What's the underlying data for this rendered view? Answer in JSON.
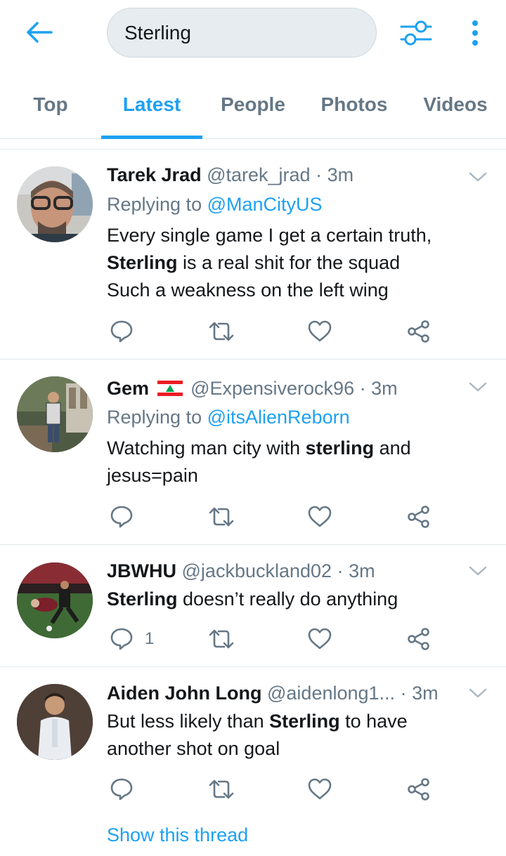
{
  "search": {
    "value": "Sterling"
  },
  "tabs": [
    {
      "label": "Top"
    },
    {
      "label": "Latest"
    },
    {
      "label": "People"
    },
    {
      "label": "Photos"
    },
    {
      "label": "Videos"
    }
  ],
  "active_tab": "Latest",
  "colors": {
    "accent": "#1da1f2",
    "secondary_text": "#657786",
    "primary_text": "#14171a",
    "divider": "#e1e8ed"
  },
  "tweets": [
    {
      "name": "Tarek Jrad",
      "handle": "@tarek_jrad",
      "dot": "·",
      "time": "3m",
      "replying_prefix": "Replying to",
      "replying_to": "@ManCityUS",
      "text_line1": "Every single game I get a certain truth,",
      "text_line2_bold": "Sterling",
      "text_line2_rest": " is a real shit  for the squad",
      "text_line3": "Such a weakness on the left wing"
    },
    {
      "name": "Gem",
      "flag_icon": "lebanon-flag-icon",
      "handle": "@Expensiverock96",
      "dot": "·",
      "time": "3m",
      "replying_prefix": "Replying to",
      "replying_to": "@itsAlienReborn",
      "text_line1_pre": "Watching man city with ",
      "text_line1_bold": "sterling",
      "text_line1_post": " and",
      "text_line2": "jesus=pain"
    },
    {
      "name": "JBWHU",
      "handle": "@jackbuckland02",
      "dot": "·",
      "time": "3m",
      "text_bold": "Sterling",
      "text_rest": " doesn’t really do anything",
      "reply_count": "1"
    },
    {
      "name": "Aiden John Long",
      "handle": "@aidenlong1...",
      "dot": "·",
      "time": "3m",
      "text_line1_pre": "But less likely than ",
      "text_line1_bold": "Sterling",
      "text_line1_post": " to have",
      "text_line2": "another shot on goal",
      "show_thread": "Show this thread"
    }
  ],
  "icons": {
    "back": "arrow-left-icon",
    "filter": "sliders-icon",
    "more": "vertical-dots-icon",
    "reply": "comment-bubble-icon",
    "retweet": "retweet-icon",
    "like": "heart-icon",
    "share": "share-icon",
    "caret": "chevron-down-icon"
  }
}
